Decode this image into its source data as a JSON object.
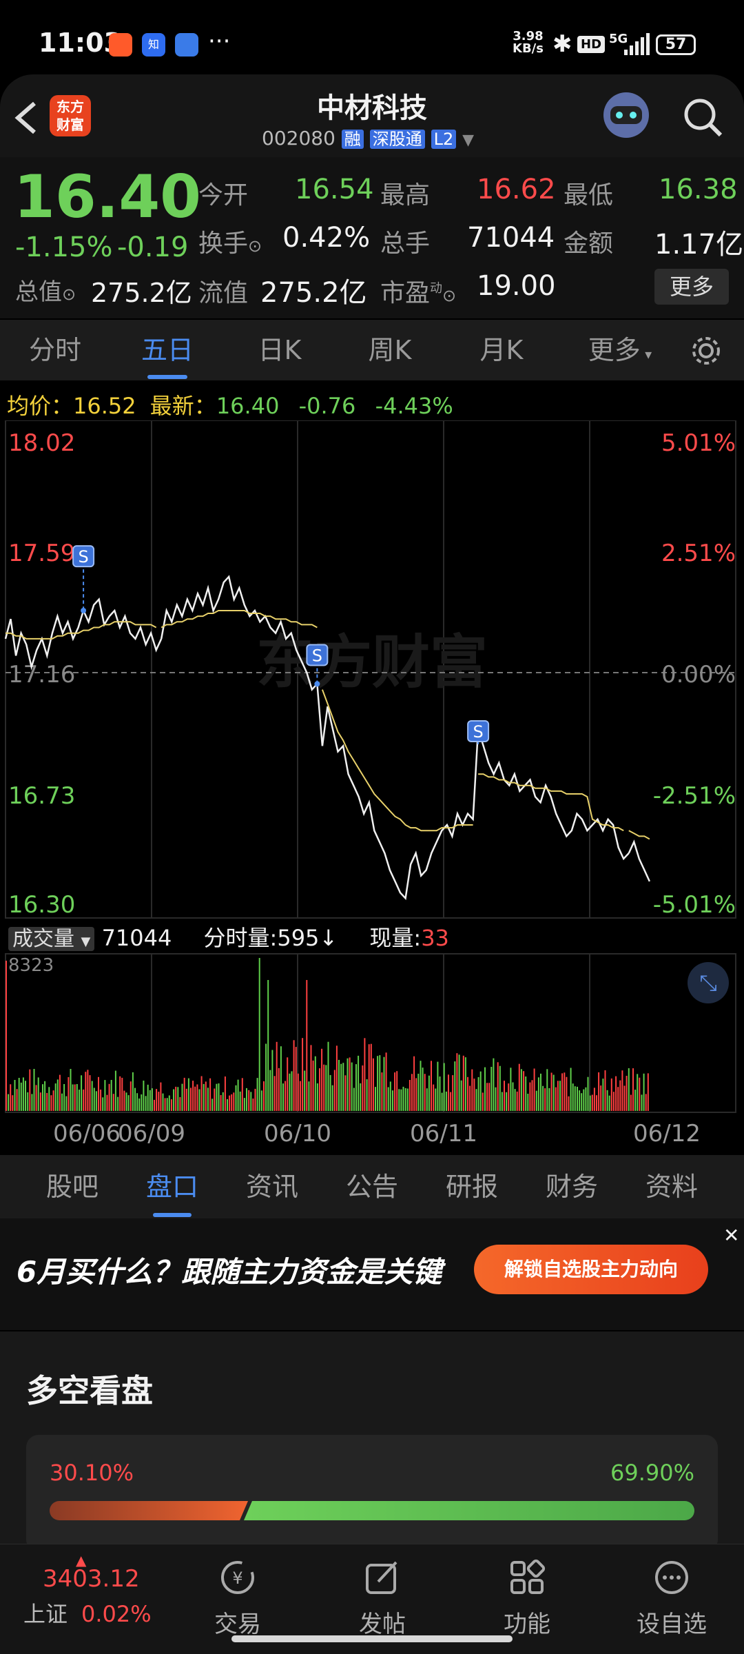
{
  "status": {
    "time": "11:03",
    "net_speed_top": "3.98",
    "net_speed_bottom": "KB/s",
    "hd": "HD",
    "signal": "5G",
    "battery": "57",
    "app_icons": [
      "app-a-icon",
      "zhihu-icon",
      "app-c-icon"
    ],
    "more": "···"
  },
  "header": {
    "title": "中材科技",
    "code": "002080",
    "tag_rong": "融",
    "tag_sgt": "深股通",
    "tag_l2": "L2",
    "logo_text_1": "东方",
    "logo_text_2": "财富"
  },
  "quote": {
    "price": "16.40",
    "change_pct": "-1.15%",
    "change_amt": "-0.19",
    "labels": {
      "open": "今开",
      "high": "最高",
      "low": "最低",
      "turnover": "换手",
      "volume": "总手",
      "amount": "金额",
      "mcap": "总值",
      "float_cap": "流值",
      "pe": "市盈",
      "pe_sup": "动"
    },
    "values": {
      "open": "16.54",
      "high": "16.62",
      "low": "16.38",
      "turnover": "0.42%",
      "volume": "71044",
      "amount": "1.17亿",
      "mcap": "275.2亿",
      "float_cap": "275.2亿",
      "pe": "19.00"
    },
    "more_button": "更多"
  },
  "tabs": [
    "分时",
    "五日",
    "日K",
    "周K",
    "月K"
  ],
  "tabs_more": "更多",
  "active_tab": "五日",
  "price_info": {
    "avg_label": "均价：",
    "avg_value": "16.52",
    "latest_label": "最新：",
    "latest_value": "16.40",
    "chg": "-0.76",
    "chg_pct": "-4.43%"
  },
  "chart_data": {
    "type": "line",
    "y_ticks_left": [
      "18.02",
      "17.59",
      "17.16",
      "16.73",
      "16.30"
    ],
    "y_ticks_right": [
      "5.01%",
      "2.51%",
      "0.00%",
      "-2.51%",
      "-5.01%"
    ],
    "ylim": [
      16.3,
      18.02
    ],
    "prev_close": 17.16,
    "x_labels": [
      "06/06",
      "06/09",
      "06/10",
      "06/11",
      "06/12"
    ],
    "watermark": "东方财富",
    "sell_marker": "S",
    "series": [
      {
        "values": [
          17.28,
          17.35,
          17.22,
          17.3,
          17.26,
          17.18,
          17.24,
          17.28,
          17.22,
          17.3,
          17.36,
          17.3,
          17.34,
          17.28,
          17.32,
          17.38,
          17.34,
          17.4,
          17.42,
          17.33,
          17.36,
          17.38,
          17.32,
          17.36,
          17.3,
          17.28,
          17.32,
          17.26,
          17.3,
          17.24,
          17.28,
          17.38,
          17.34,
          17.4,
          17.36,
          17.42,
          17.38,
          17.44,
          17.4,
          17.46,
          17.38,
          17.42,
          17.48,
          17.5,
          17.42,
          17.46,
          17.4,
          17.36,
          17.38,
          17.34,
          17.36,
          17.32,
          17.3,
          17.34,
          17.28,
          17.3,
          17.24,
          17.2,
          17.16,
          17.1,
          17.12,
          16.9,
          17.04,
          16.96,
          16.88,
          16.9,
          16.8,
          16.76,
          16.72,
          16.66,
          16.7,
          16.6,
          16.56,
          16.52,
          16.46,
          16.42,
          16.38,
          16.36,
          16.48,
          16.52,
          16.44,
          16.46,
          16.52,
          16.56,
          16.6,
          16.62,
          16.58,
          16.66,
          16.62,
          16.66,
          16.64,
          16.96,
          16.9,
          16.84,
          16.8,
          16.84,
          16.78,
          16.76,
          16.8,
          16.74,
          16.76,
          16.78,
          16.72,
          16.7,
          16.76,
          16.72,
          16.66,
          16.62,
          16.58,
          16.6,
          16.66,
          16.64,
          16.6,
          16.62,
          16.64,
          16.6,
          16.64,
          16.62,
          16.54,
          16.5,
          16.52,
          16.56,
          16.5,
          16.46,
          16.42
        ]
      },
      {
        "values": [
          17.3,
          17.3,
          17.29,
          17.29,
          17.28,
          17.28,
          17.28,
          17.28,
          17.28,
          17.28,
          17.29,
          17.29,
          17.3,
          17.3,
          17.3,
          17.31,
          17.31,
          17.32,
          17.32,
          17.33,
          17.33,
          17.34,
          17.34,
          17.34,
          17.34,
          17.33,
          17.33,
          17.33,
          17.33,
          17.32,
          17.32,
          17.33,
          17.33,
          17.34,
          17.34,
          17.35,
          17.35,
          17.36,
          17.36,
          17.37,
          17.37,
          17.38,
          17.38,
          17.38,
          17.38,
          17.38,
          17.38,
          17.37,
          17.37,
          17.37,
          17.36,
          17.36,
          17.35,
          17.35,
          17.35,
          17.34,
          17.34,
          17.33,
          17.33,
          17.33,
          17.32,
          17.1,
          17.05,
          17.0,
          16.95,
          16.92,
          16.88,
          16.85,
          16.82,
          16.79,
          16.76,
          16.73,
          16.71,
          16.69,
          16.67,
          16.65,
          16.64,
          16.62,
          16.61,
          16.61,
          16.6,
          16.6,
          16.6,
          16.6,
          16.61,
          16.61,
          16.61,
          16.62,
          16.62,
          16.62,
          16.62,
          16.8,
          16.8,
          16.79,
          16.79,
          16.78,
          16.78,
          16.77,
          16.77,
          16.76,
          16.76,
          16.76,
          16.75,
          16.75,
          16.75,
          16.74,
          16.74,
          16.74,
          16.73,
          16.73,
          16.73,
          16.73,
          16.72,
          16.64,
          16.63,
          16.62,
          16.62,
          16.61,
          16.61,
          16.6,
          16.6,
          16.59,
          16.58,
          16.58,
          16.57
        ]
      }
    ],
    "markers": [
      {
        "index": 15,
        "price": 17.57
      },
      {
        "index": 60,
        "price": 17.22
      },
      {
        "index": 91,
        "price": 16.95
      }
    ]
  },
  "volume": {
    "label": "成交量",
    "total": "71044",
    "fenshi_label": "分时量:",
    "fenshi_value": "595",
    "xianliang_label": "现量:",
    "xianliang_value": "33",
    "max": "8323"
  },
  "subtabs": [
    "股吧",
    "盘口",
    "资讯",
    "公告",
    "研报",
    "财务",
    "资料"
  ],
  "active_subtab": "盘口",
  "banner": {
    "headline": "6月买什么？跟随主力资金是关键",
    "button": "解锁自选股主力动向"
  },
  "duokong": {
    "title": "多空看盘",
    "bear_pct": "30.10%",
    "bull_pct": "69.90%",
    "bear_fraction": 0.301
  },
  "bottom": {
    "index_value": "3403.12",
    "index_name": "上证",
    "index_chg": "0.02%",
    "nav": [
      "交易",
      "发帖",
      "功能",
      "设自选"
    ]
  }
}
